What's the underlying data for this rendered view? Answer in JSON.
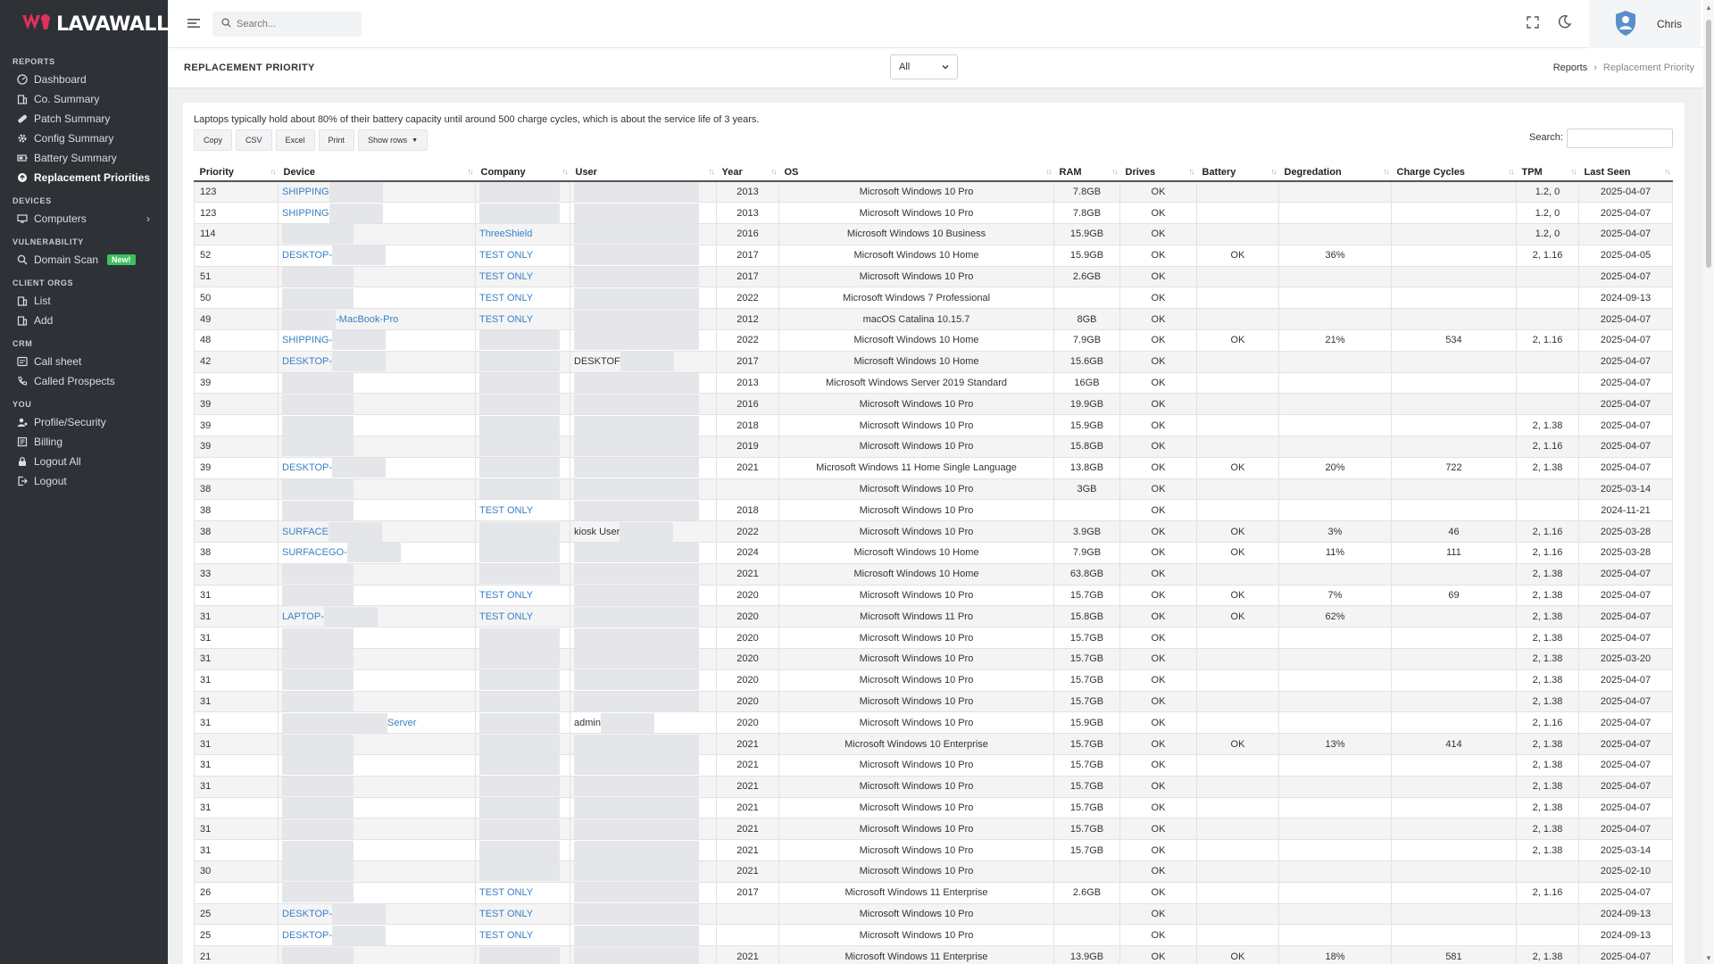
{
  "brand": {
    "name": "LAVAWALL",
    "reg": "®"
  },
  "sidebar": {
    "sections": [
      {
        "title": "REPORTS",
        "items": [
          {
            "label": "Dashboard",
            "icon": "dashboard-icon",
            "active": false
          },
          {
            "label": "Co. Summary",
            "icon": "building-icon",
            "active": false
          },
          {
            "label": "Patch Summary",
            "icon": "bandage-icon",
            "active": false
          },
          {
            "label": "Config Summary",
            "icon": "gear-icon",
            "active": false
          },
          {
            "label": "Battery Summary",
            "icon": "battery-icon",
            "active": false
          },
          {
            "label": "Replacement Priorities",
            "icon": "replace-icon",
            "active": true
          }
        ]
      },
      {
        "title": "DEVICES",
        "items": [
          {
            "label": "Computers",
            "icon": "monitor-icon",
            "active": false,
            "chevron": "›"
          }
        ]
      },
      {
        "title": "VULNERABILITY",
        "items": [
          {
            "label": "Domain Scan",
            "icon": "search-icon",
            "active": false,
            "badge": "New!"
          }
        ]
      },
      {
        "title": "CLIENT ORGS",
        "items": [
          {
            "label": "List",
            "icon": "list-icon",
            "active": false
          },
          {
            "label": "Add",
            "icon": "add-icon",
            "active": false
          }
        ]
      },
      {
        "title": "CRM",
        "items": [
          {
            "label": "Call sheet",
            "icon": "sheet-icon",
            "active": false
          },
          {
            "label": "Called Prospects",
            "icon": "phone-icon",
            "active": false
          }
        ]
      },
      {
        "title": "YOU",
        "items": [
          {
            "label": "Profile/Security",
            "icon": "user-gear-icon",
            "active": false
          },
          {
            "label": "Billing",
            "icon": "billing-icon",
            "active": false
          },
          {
            "label": "Logout All",
            "icon": "lock-icon",
            "active": false
          },
          {
            "label": "Logout",
            "icon": "logout-icon",
            "active": false
          }
        ]
      }
    ]
  },
  "topbar": {
    "search_placeholder": "Search...",
    "user": "Chris"
  },
  "page": {
    "title": "REPLACEMENT PRIORITY",
    "filter_value": "All",
    "breadcrumb": {
      "parent": "Reports",
      "separator": "›",
      "current": "Replacement Priority"
    },
    "note": "Laptops typically hold about 80% of their battery capacity until around 500 charge cycles, which is about the service life of 3 years.",
    "buttons": [
      "Copy",
      "CSV",
      "Excel",
      "Print",
      "Show rows"
    ],
    "show_rows_caret": "▼",
    "search_label": "Search:"
  },
  "table": {
    "columns": [
      "Priority",
      "Device",
      "Company",
      "User",
      "Year",
      "OS",
      "RAM",
      "Drives",
      "Battery",
      "Degredation",
      "Charge Cycles",
      "TPM",
      "Last Seen"
    ],
    "sort_glyph": "↑↓",
    "rows": [
      {
        "priority": "123",
        "device": "SHIPPING",
        "company": "",
        "user": "",
        "year": "2013",
        "os": "Microsoft Windows 10 Pro",
        "ram": "7.8GB",
        "drives": "OK",
        "battery": "",
        "degr": "",
        "cycles": "",
        "tpm": "1.2, 0",
        "last": "2025-04-07"
      },
      {
        "priority": "123",
        "device": "SHIPPING",
        "company": "",
        "user": "",
        "year": "2013",
        "os": "Microsoft Windows 10 Pro",
        "ram": "7.8GB",
        "drives": "OK",
        "battery": "",
        "degr": "",
        "cycles": "",
        "tpm": "1.2, 0",
        "last": "2025-04-07"
      },
      {
        "priority": "114",
        "device": "",
        "company": "ThreeShield",
        "user": "",
        "year": "2016",
        "os": "Microsoft Windows 10 Business",
        "ram": "15.9GB",
        "drives": "OK",
        "battery": "",
        "degr": "",
        "cycles": "",
        "tpm": "1.2, 0",
        "last": "2025-04-07"
      },
      {
        "priority": "52",
        "device": "DESKTOP-",
        "company": "TEST ONLY",
        "user": "",
        "year": "2017",
        "os": "Microsoft Windows 10 Home",
        "ram": "15.9GB",
        "drives": "OK",
        "battery": "OK",
        "degr": "36%",
        "cycles": "",
        "tpm": "2, 1.16",
        "last": "2025-04-05"
      },
      {
        "priority": "51",
        "device": "",
        "company": "TEST ONLY",
        "user": "",
        "year": "2017",
        "os": "Microsoft Windows 10 Pro",
        "ram": "2.6GB",
        "drives": "OK",
        "battery": "",
        "degr": "",
        "cycles": "",
        "tpm": "",
        "last": "2025-04-07"
      },
      {
        "priority": "50",
        "device": "",
        "company": "TEST ONLY",
        "user": "",
        "year": "2022",
        "os": "Microsoft Windows 7 Professional",
        "ram": "",
        "drives": "OK",
        "battery": "",
        "degr": "",
        "cycles": "",
        "tpm": "",
        "last": "2024-09-13"
      },
      {
        "priority": "49",
        "device": "-MacBook-Pro",
        "company": "TEST ONLY",
        "user": "",
        "year": "2012",
        "os": "macOS Catalina 10.15.7",
        "ram": "8GB",
        "drives": "OK",
        "battery": "",
        "degr": "",
        "cycles": "",
        "tpm": "",
        "last": "2025-04-07"
      },
      {
        "priority": "48",
        "device": "SHIPPING-",
        "company": "",
        "user": "",
        "year": "2022",
        "os": "Microsoft Windows 10 Home",
        "ram": "7.9GB",
        "drives": "OK",
        "battery": "OK",
        "degr": "21%",
        "cycles": "534",
        "tpm": "2, 1.16",
        "last": "2025-04-07"
      },
      {
        "priority": "42",
        "device": "DESKTOP-",
        "company": "",
        "user": "DESKTOF",
        "year": "2017",
        "os": "Microsoft Windows 10 Home",
        "ram": "15.6GB",
        "drives": "OK",
        "battery": "",
        "degr": "",
        "cycles": "",
        "tpm": "",
        "last": "2025-04-07"
      },
      {
        "priority": "39",
        "device": "",
        "company": "",
        "user": "",
        "year": "2013",
        "os": "Microsoft Windows Server 2019 Standard",
        "ram": "16GB",
        "drives": "OK",
        "battery": "",
        "degr": "",
        "cycles": "",
        "tpm": "",
        "last": "2025-04-07"
      },
      {
        "priority": "39",
        "device": "",
        "company": "",
        "user": "",
        "year": "2016",
        "os": "Microsoft Windows 10 Pro",
        "ram": "19.9GB",
        "drives": "OK",
        "battery": "",
        "degr": "",
        "cycles": "",
        "tpm": "",
        "last": "2025-04-07"
      },
      {
        "priority": "39",
        "device": "",
        "company": "",
        "user": "",
        "year": "2018",
        "os": "Microsoft Windows 10 Pro",
        "ram": "15.9GB",
        "drives": "OK",
        "battery": "",
        "degr": "",
        "cycles": "",
        "tpm": "2, 1.38",
        "last": "2025-04-07"
      },
      {
        "priority": "39",
        "device": "",
        "company": "",
        "user": "",
        "year": "2019",
        "os": "Microsoft Windows 10 Pro",
        "ram": "15.8GB",
        "drives": "OK",
        "battery": "",
        "degr": "",
        "cycles": "",
        "tpm": "2, 1.16",
        "last": "2025-04-07"
      },
      {
        "priority": "39",
        "device": "DESKTOP-",
        "company": "",
        "user": "",
        "year": "2021",
        "os": "Microsoft Windows 11 Home Single Language",
        "ram": "13.8GB",
        "drives": "OK",
        "battery": "OK",
        "degr": "20%",
        "cycles": "722",
        "tpm": "2, 1.38",
        "last": "2025-04-07"
      },
      {
        "priority": "38",
        "device": "",
        "company": "",
        "user": "",
        "year": "",
        "os": "Microsoft Windows 10 Pro",
        "ram": "3GB",
        "drives": "OK",
        "battery": "",
        "degr": "",
        "cycles": "",
        "tpm": "",
        "last": "2025-03-14"
      },
      {
        "priority": "38",
        "device": "",
        "company": "TEST ONLY",
        "user": "",
        "year": "2018",
        "os": "Microsoft Windows 10 Pro",
        "ram": "",
        "drives": "OK",
        "battery": "",
        "degr": "",
        "cycles": "",
        "tpm": "",
        "last": "2024-11-21"
      },
      {
        "priority": "38",
        "device": "SURFACE",
        "company": "",
        "user": "kiosk User",
        "year": "2022",
        "os": "Microsoft Windows 10 Pro",
        "ram": "3.9GB",
        "drives": "OK",
        "battery": "OK",
        "degr": "3%",
        "cycles": "46",
        "tpm": "2, 1.16",
        "last": "2025-03-28"
      },
      {
        "priority": "38",
        "device": "SURFACEGO-",
        "company": "",
        "user": "",
        "year": "2024",
        "os": "Microsoft Windows 10 Home",
        "ram": "7.9GB",
        "drives": "OK",
        "battery": "OK",
        "degr": "11%",
        "cycles": "111",
        "tpm": "2, 1.16",
        "last": "2025-03-28"
      },
      {
        "priority": "33",
        "device": "",
        "company": "",
        "user": "",
        "year": "2021",
        "os": "Microsoft Windows 10 Home",
        "ram": "63.8GB",
        "drives": "OK",
        "battery": "",
        "degr": "",
        "cycles": "",
        "tpm": "2, 1.38",
        "last": "2025-04-07"
      },
      {
        "priority": "31",
        "device": "",
        "company": "TEST ONLY",
        "user": "",
        "year": "2020",
        "os": "Microsoft Windows 10 Pro",
        "ram": "15.7GB",
        "drives": "OK",
        "battery": "OK",
        "degr": "7%",
        "cycles": "69",
        "tpm": "2, 1.38",
        "last": "2025-04-07"
      },
      {
        "priority": "31",
        "device": "LAPTOP-",
        "company": "TEST ONLY",
        "user": "",
        "year": "2020",
        "os": "Microsoft Windows 11 Pro",
        "ram": "15.8GB",
        "drives": "OK",
        "battery": "OK",
        "degr": "62%",
        "cycles": "",
        "tpm": "2, 1.38",
        "last": "2025-04-07"
      },
      {
        "priority": "31",
        "device": "",
        "company": "",
        "user": "",
        "year": "2020",
        "os": "Microsoft Windows 10 Pro",
        "ram": "15.7GB",
        "drives": "OK",
        "battery": "",
        "degr": "",
        "cycles": "",
        "tpm": "2, 1.38",
        "last": "2025-04-07"
      },
      {
        "priority": "31",
        "device": "",
        "company": "",
        "user": "",
        "year": "2020",
        "os": "Microsoft Windows 10 Pro",
        "ram": "15.7GB",
        "drives": "OK",
        "battery": "",
        "degr": "",
        "cycles": "",
        "tpm": "2, 1.38",
        "last": "2025-03-20"
      },
      {
        "priority": "31",
        "device": "",
        "company": "",
        "user": "",
        "year": "2020",
        "os": "Microsoft Windows 10 Pro",
        "ram": "15.7GB",
        "drives": "OK",
        "battery": "",
        "degr": "",
        "cycles": "",
        "tpm": "2, 1.38",
        "last": "2025-04-07"
      },
      {
        "priority": "31",
        "device": "",
        "company": "",
        "user": "",
        "year": "2020",
        "os": "Microsoft Windows 10 Pro",
        "ram": "15.7GB",
        "drives": "OK",
        "battery": "",
        "degr": "",
        "cycles": "",
        "tpm": "2, 1.38",
        "last": "2025-04-07"
      },
      {
        "priority": "31",
        "device": "Server",
        "company": "",
        "user": "admin",
        "year": "2020",
        "os": "Microsoft Windows 10 Pro",
        "ram": "15.9GB",
        "drives": "OK",
        "battery": "",
        "degr": "",
        "cycles": "",
        "tpm": "2, 1.16",
        "last": "2025-04-07"
      },
      {
        "priority": "31",
        "device": "",
        "company": "",
        "user": "",
        "year": "2021",
        "os": "Microsoft Windows 10 Enterprise",
        "ram": "15.7GB",
        "drives": "OK",
        "battery": "OK",
        "degr": "13%",
        "cycles": "414",
        "tpm": "2, 1.38",
        "last": "2025-04-07"
      },
      {
        "priority": "31",
        "device": "",
        "company": "",
        "user": "",
        "year": "2021",
        "os": "Microsoft Windows 10 Pro",
        "ram": "15.7GB",
        "drives": "OK",
        "battery": "",
        "degr": "",
        "cycles": "",
        "tpm": "2, 1.38",
        "last": "2025-04-07"
      },
      {
        "priority": "31",
        "device": "",
        "company": "",
        "user": "",
        "year": "2021",
        "os": "Microsoft Windows 10 Pro",
        "ram": "15.7GB",
        "drives": "OK",
        "battery": "",
        "degr": "",
        "cycles": "",
        "tpm": "2, 1.38",
        "last": "2025-04-07"
      },
      {
        "priority": "31",
        "device": "",
        "company": "",
        "user": "",
        "year": "2021",
        "os": "Microsoft Windows 10 Pro",
        "ram": "15.7GB",
        "drives": "OK",
        "battery": "",
        "degr": "",
        "cycles": "",
        "tpm": "2, 1.38",
        "last": "2025-04-07"
      },
      {
        "priority": "31",
        "device": "",
        "company": "",
        "user": "",
        "year": "2021",
        "os": "Microsoft Windows 10 Pro",
        "ram": "15.7GB",
        "drives": "OK",
        "battery": "",
        "degr": "",
        "cycles": "",
        "tpm": "2, 1.38",
        "last": "2025-04-07"
      },
      {
        "priority": "31",
        "device": "",
        "company": "",
        "user": "",
        "year": "2021",
        "os": "Microsoft Windows 10 Pro",
        "ram": "15.7GB",
        "drives": "OK",
        "battery": "",
        "degr": "",
        "cycles": "",
        "tpm": "2, 1.38",
        "last": "2025-03-14"
      },
      {
        "priority": "30",
        "device": "",
        "company": "",
        "user": "",
        "year": "2021",
        "os": "Microsoft Windows 10 Pro",
        "ram": "",
        "drives": "OK",
        "battery": "",
        "degr": "",
        "cycles": "",
        "tpm": "",
        "last": "2025-02-10"
      },
      {
        "priority": "26",
        "device": "",
        "company": "TEST ONLY",
        "user": "",
        "year": "2017",
        "os": "Microsoft Windows 11 Enterprise",
        "ram": "2.6GB",
        "drives": "OK",
        "battery": "",
        "degr": "",
        "cycles": "",
        "tpm": "2, 1.16",
        "last": "2025-04-07"
      },
      {
        "priority": "25",
        "device": "DESKTOP-",
        "company": "TEST ONLY",
        "user": "",
        "year": "",
        "os": "Microsoft Windows 10 Pro",
        "ram": "",
        "drives": "OK",
        "battery": "",
        "degr": "",
        "cycles": "",
        "tpm": "",
        "last": "2024-09-13"
      },
      {
        "priority": "25",
        "device": "DESKTOP-",
        "company": "TEST ONLY",
        "user": "",
        "year": "",
        "os": "Microsoft Windows 10 Pro",
        "ram": "",
        "drives": "OK",
        "battery": "",
        "degr": "",
        "cycles": "",
        "tpm": "",
        "last": "2024-09-13"
      },
      {
        "priority": "21",
        "device": "",
        "company": "",
        "user": "",
        "year": "2021",
        "os": "Microsoft Windows 11 Enterprise",
        "ram": "13.9GB",
        "drives": "OK",
        "battery": "OK",
        "degr": "18%",
        "cycles": "581",
        "tpm": "2, 1.38",
        "last": "2025-04-07"
      }
    ]
  }
}
